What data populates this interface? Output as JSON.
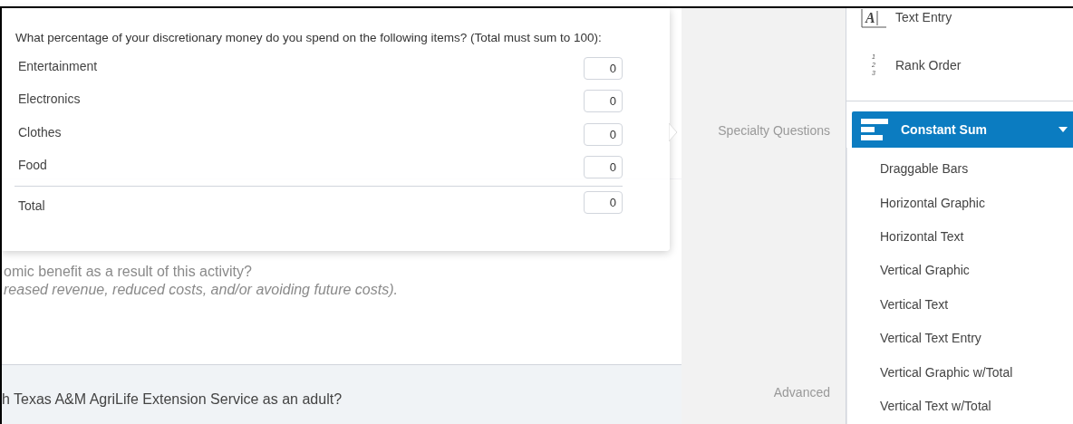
{
  "background": {
    "question_lines": [
      "omic benefit as a result of this activity?",
      "reased revenue, reduced costs, and/or avoiding future costs)."
    ],
    "footer_question": "h Texas A&M AgriLife Extension Service as an adult?"
  },
  "preview": {
    "prompt": "What percentage of your discretionary money do you spend on the following items? (Total must sum to 100):",
    "items": [
      {
        "label": "Entertainment",
        "value": "0"
      },
      {
        "label": "Electronics",
        "value": "0"
      },
      {
        "label": "Clothes",
        "value": "0"
      },
      {
        "label": "Food",
        "value": "0"
      }
    ],
    "total": {
      "label": "Total",
      "value": "0"
    }
  },
  "sections": [
    "Specialty Questions",
    "Advanced"
  ],
  "question_types": [
    {
      "kind": "text",
      "label": "Text Entry",
      "icon": [
        "A"
      ]
    },
    {
      "kind": "rank",
      "label": "Rank Order",
      "icon": [
        "1",
        "2",
        "3"
      ]
    }
  ],
  "selected_type": {
    "label": "Constant Sum",
    "expanded": true
  },
  "variants": [
    "Draggable Bars",
    "Horizontal Graphic",
    "Horizontal Text",
    "Vertical Graphic",
    "Vertical Text",
    "Vertical Text Entry",
    "Vertical Graphic w/Total",
    "Vertical Text w/Total"
  ]
}
